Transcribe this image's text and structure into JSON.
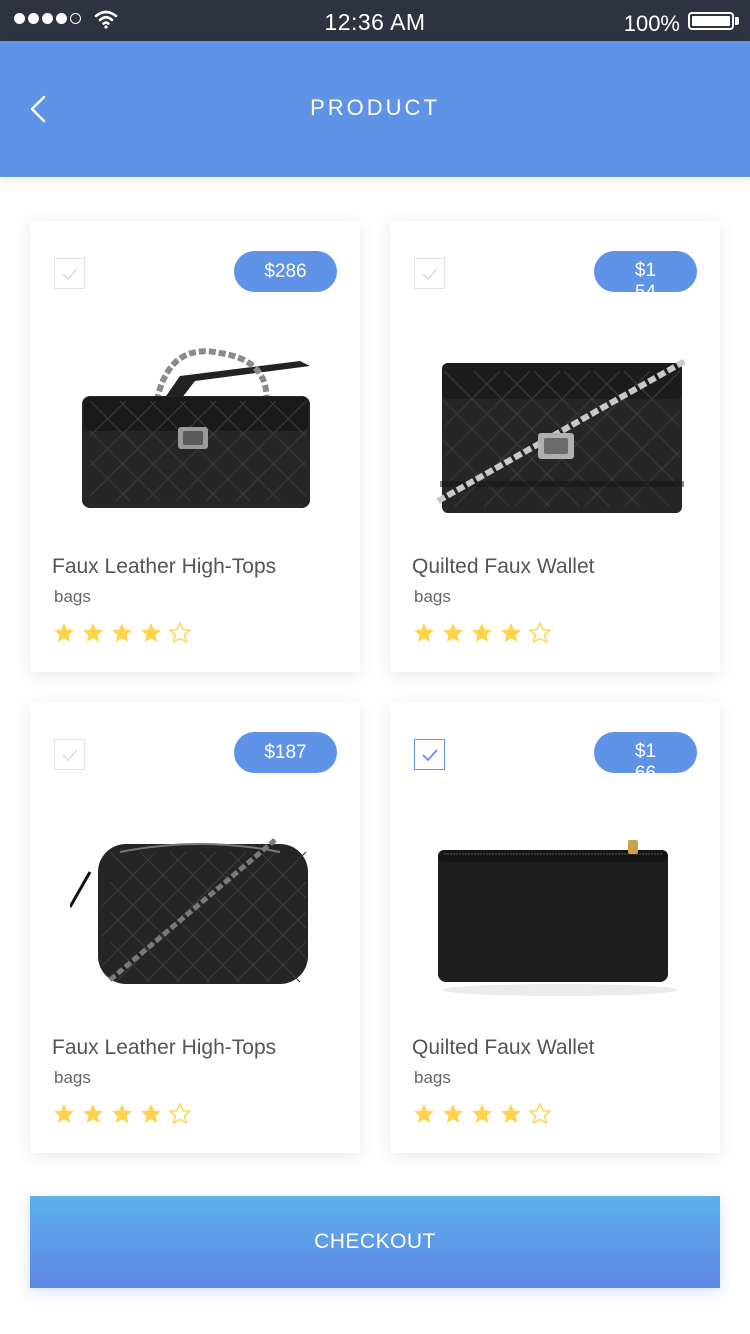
{
  "status_bar": {
    "time": "12:36 AM",
    "battery_percent": "100%",
    "signal_bars_filled": 4,
    "signal_bars_total": 5
  },
  "header": {
    "title": "PRODUCT",
    "back_icon": "chevron-left-icon"
  },
  "products": [
    {
      "name": "Faux Leather High-Tops",
      "category": "bags",
      "price": "$286",
      "checked": false,
      "rating": 4,
      "rating_max": 5,
      "image": "quilted-chain-shoulder-bag"
    },
    {
      "name": "Quilted Faux Wallet",
      "category": "bags",
      "price": "$154",
      "checked": false,
      "rating": 4,
      "rating_max": 5,
      "image": "quilted-chain-wallet"
    },
    {
      "name": "Faux Leather High-Tops",
      "category": "bags",
      "price": "$187",
      "checked": false,
      "rating": 4,
      "rating_max": 5,
      "image": "quilted-camera-bag"
    },
    {
      "name": "Quilted Faux Wallet",
      "category": "bags",
      "price": "$166",
      "checked": true,
      "rating": 4,
      "rating_max": 5,
      "image": "zip-wallet"
    }
  ],
  "checkout": {
    "label": "CHECKOUT"
  },
  "colors": {
    "accent": "#5e93e8",
    "status_bar": "#2f3240",
    "star_filled": "#ffd34e",
    "star_empty": "#ffd34e"
  }
}
